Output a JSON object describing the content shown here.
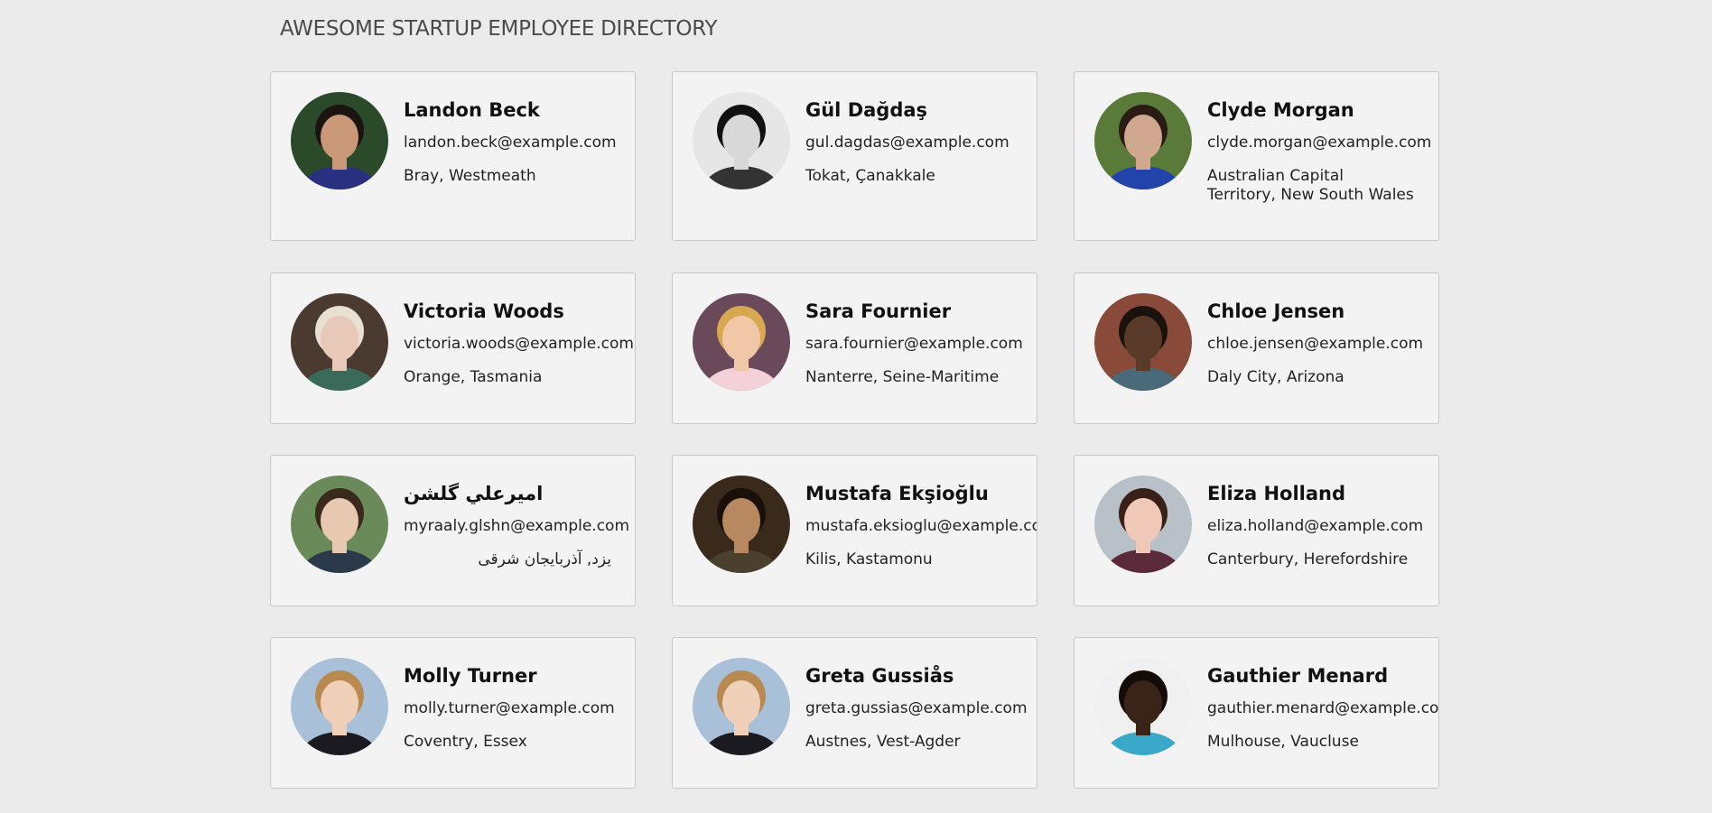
{
  "header": {
    "title": "AWESOME STARTUP EMPLOYEE DIRECTORY"
  },
  "employees": [
    {
      "name": "Landon Beck",
      "email": "landon.beck@example.com",
      "location": "Bray, Westmeath",
      "bg": "#2a4a2a",
      "skin": "#c89878",
      "hair": "#1c1410",
      "shirt": "#2a3080"
    },
    {
      "name": "Gül Dağdaş",
      "email": "gul.dagdas@example.com",
      "location": "Tokat, Çanakkale",
      "bg": "#e6e6e6",
      "skin": "#d8d8d8",
      "hair": "#111111",
      "shirt": "#333333"
    },
    {
      "name": "Clyde Morgan",
      "email": "clyde.morgan@example.com",
      "location": "Australian Capital Territory, New South Wales",
      "bg": "#5a7a3a",
      "skin": "#d0a890",
      "hair": "#2a1c14",
      "shirt": "#2244aa"
    },
    {
      "name": "Victoria Woods",
      "email": "victoria.woods@example.com",
      "location": "Orange, Tasmania",
      "bg": "#4a3a30",
      "skin": "#e8c8b8",
      "hair": "#e8e0d0",
      "shirt": "#3a6a5a"
    },
    {
      "name": "Sara Fournier",
      "email": "sara.fournier@example.com",
      "location": "Nanterre, Seine-Maritime",
      "bg": "#6a4a5a",
      "skin": "#f0c8a8",
      "hair": "#d8a850",
      "shirt": "#f4d0d8"
    },
    {
      "name": "Chloe Jensen",
      "email": "chloe.jensen@example.com",
      "location": "Daly City, Arizona",
      "bg": "#8a4a3a",
      "skin": "#5a3a28",
      "hair": "#1a120c",
      "shirt": "#4a6a7a"
    },
    {
      "name": "اميرعلي گلشن",
      "email": "myraaly.glshn@example.com",
      "location": "يزد, آذربايجان شرقى",
      "bg": "#6a8a5a",
      "skin": "#e8c8b0",
      "hair": "#3a2a1c",
      "shirt": "#2a3a4a"
    },
    {
      "name": "Mustafa Ekşioğlu",
      "email": "mustafa.eksioglu@example.com",
      "location": "Kilis, Kastamonu",
      "bg": "#3a2a1c",
      "skin": "#b88860",
      "hair": "#1a100a",
      "shirt": "#4a4030"
    },
    {
      "name": "Eliza Holland",
      "email": "eliza.holland@example.com",
      "location": "Canterbury, Herefordshire",
      "bg": "#b8c0c8",
      "skin": "#f0c8b8",
      "hair": "#3a2018",
      "shirt": "#5a2a3a"
    },
    {
      "name": "Molly Turner",
      "email": "molly.turner@example.com",
      "location": "Coventry, Essex",
      "bg": "#a8c0d8",
      "skin": "#f0d0b8",
      "hair": "#b88a50",
      "shirt": "#1a1a20"
    },
    {
      "name": "Greta Gussiås",
      "email": "greta.gussias@example.com",
      "location": "Austnes, Vest-Agder",
      "bg": "#a8c0d8",
      "skin": "#f0d0b8",
      "hair": "#b88a50",
      "shirt": "#1a1a20"
    },
    {
      "name": "Gauthier Menard",
      "email": "gauthier.menard@example.com",
      "location": "Mulhouse, Vaucluse",
      "bg": "#f0f0f0",
      "skin": "#3a2418",
      "hair": "#140c08",
      "shirt": "#3aa8c8"
    }
  ]
}
